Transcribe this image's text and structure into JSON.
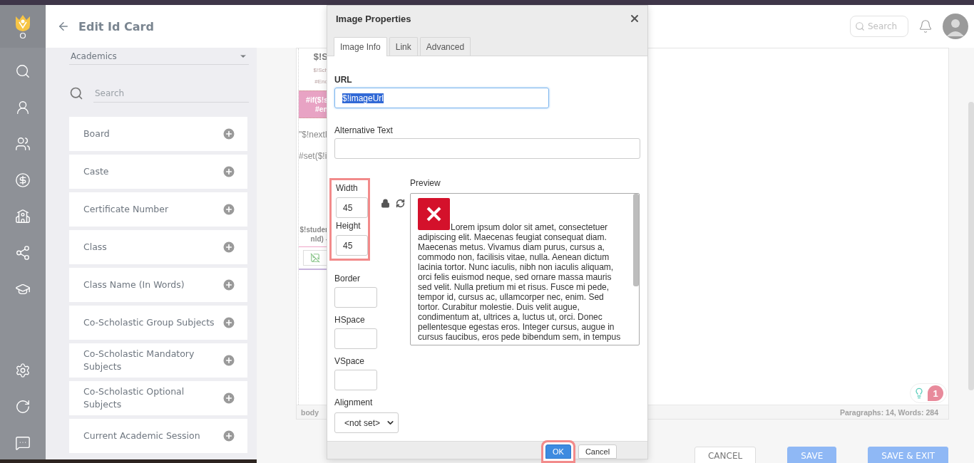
{
  "header": {
    "title": "Edit Id Card",
    "search": {
      "placeholder": "Search"
    }
  },
  "sidebar": {
    "category": "Academics",
    "search": {
      "placeholder": "Search"
    },
    "fields": [
      "Board",
      "Caste",
      "Certificate Number",
      "Class",
      "Class Name (In Words)",
      "Co-Scholastic Group Subjects",
      "Co-Scholastic Mandatory Subjects",
      "Co-Scholastic Optional Subjects",
      "Current Academic Session"
    ]
  },
  "editor": {
    "fragments": [
      {
        "kind": "heading",
        "text": "$!S"
      },
      {
        "kind": "small",
        "text": "$!Sch"
      },
      {
        "kind": "small",
        "text": "#End"
      },
      {
        "kind": "highlight",
        "lines": [
          "#if($!s",
          "#en"
        ]
      },
      {
        "kind": "text",
        "text": "\"$!nextl"
      },
      {
        "kind": "text",
        "text": "#set($!i"
      },
      {
        "kind": "bold",
        "lines": [
          "$!studer",
          "nld) -"
        ]
      },
      {
        "kind": "image"
      }
    ],
    "status_path": "body",
    "word_count": "Paragraphs: 14, Words: 284",
    "help_badge": "1"
  },
  "actions": [
    {
      "label": "CANCEL",
      "kind": "outline"
    },
    {
      "label": "SAVE",
      "kind": "primary"
    },
    {
      "label": "SAVE & EXIT",
      "kind": "primary"
    }
  ],
  "dialog": {
    "title": "Image Properties",
    "tabs": [
      {
        "label": "Image Info",
        "selected": true
      },
      {
        "label": "Link",
        "selected": false
      },
      {
        "label": "Advanced",
        "selected": false
      }
    ],
    "url": {
      "label": "URL",
      "value": "$!imageUrl",
      "value_selected": true
    },
    "alt_text": {
      "label": "Alternative Text"
    },
    "size_highlighted": true,
    "width": {
      "label": "Width",
      "value": "45"
    },
    "height": {
      "label": "Height",
      "value": "45"
    },
    "border": {
      "label": "Border"
    },
    "hspace": {
      "label": "HSpace"
    },
    "vspace": {
      "label": "VSpace"
    },
    "alignment": {
      "label": "Alignment",
      "value": "<not set>"
    },
    "preview": {
      "label": "Preview",
      "text": "Lorem ipsum dolor sit amet, consectetuer adipiscing elit. Maecenas feugiat consequat diam. Maecenas metus. Vivamus diam purus, cursus a, commodo non, facilisis vitae, nulla. Aenean dictum lacinia tortor. Nunc iaculis, nibh non iaculis aliquam, orci felis euismod neque, sed ornare massa mauris sed velit. Nulla pretium mi et risus. Fusce mi pede, tempor id, cursus ac, ullamcorper nec, enim. Sed tortor. Curabitur molestie. Duis velit augue, condimentum at, ultrices a, luctus ut, orci. Donec pellentesque egestas eros. Integer cursus, augue in cursus faucibus, eros pede bibendum sem, in tempus"
    },
    "buttons": [
      {
        "label": "OK",
        "kind": "primary",
        "highlighted": true
      },
      {
        "label": "Cancel",
        "kind": "default",
        "highlighted": false
      }
    ]
  }
}
